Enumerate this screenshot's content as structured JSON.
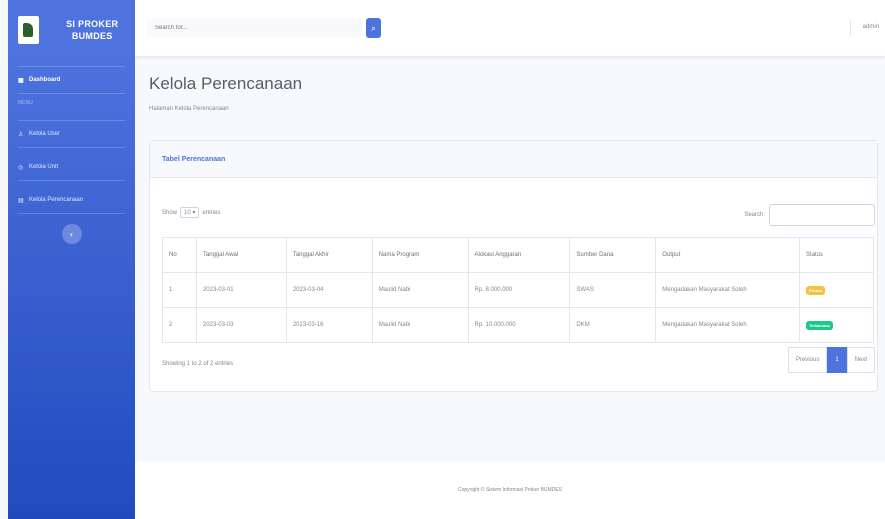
{
  "sidebar": {
    "brand": "SI PROKER BUMDES",
    "items": [
      {
        "icon": "dashboard-icon",
        "glyph": "▦",
        "label": "Dashboard"
      },
      {
        "icon": "user-icon",
        "glyph": "♙",
        "label": "Kelola User"
      },
      {
        "icon": "unit-icon",
        "glyph": "◎",
        "label": "Kelola Unit"
      },
      {
        "icon": "document-icon",
        "glyph": "▤",
        "label": "Kelola Perencanaan"
      }
    ],
    "heading": "MENU",
    "toggle_glyph": "‹"
  },
  "topbar": {
    "search_placeholder": "Search for...",
    "search_glyph": "⌕",
    "user": "admin"
  },
  "page": {
    "title": "Kelola Perencanaan",
    "subtitle": "Halaman Kelola Perencanaan"
  },
  "card": {
    "title": "Tabel Perencanaan",
    "show_label": "Show",
    "entries_value": "10",
    "entries_label": "entries",
    "search_label": "Search:",
    "columns": [
      "No",
      "Tanggal Awal",
      "Tanggal Akhir",
      "Nama Program",
      "Alokasi Anggaran",
      "Sumber Dana",
      "Output",
      "Status"
    ],
    "rows": [
      {
        "no": "1",
        "awal": "2023-03-01",
        "akhir": "2023-03-04",
        "program": "Maulid Nabi",
        "anggaran": "Rp. 8.000.000",
        "sumber": "SWAS",
        "output": "Mengadakan Masyarakat Soleh",
        "status": "Proses",
        "color": "#f6c23e"
      },
      {
        "no": "2",
        "awal": "2023-03-03",
        "akhir": "2023-03-16",
        "program": "Maulid Nabi",
        "anggaran": "Rp. 10.000.000",
        "sumber": "DKM",
        "output": "Mengadakan Masyarakat Soleh",
        "status": "Terlaksana",
        "color": "#1cc88a"
      }
    ],
    "info": "Showing 1 to 2 of 2 entries",
    "prev": "Previous",
    "page": "1",
    "next": "Next"
  },
  "footer": "Copyright © Sistem Informasi Proker BUMDES"
}
